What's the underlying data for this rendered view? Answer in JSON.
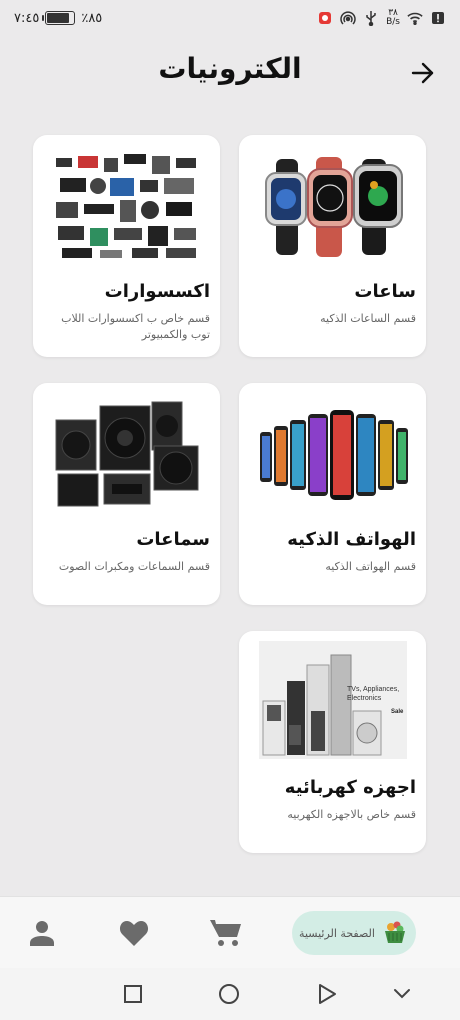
{
  "status_bar": {
    "time": "٧:٤٥",
    "battery_percent": "٪٨٥",
    "battery_level": 0.85,
    "net_speed_value": "٣٨",
    "net_speed_unit": "B/s"
  },
  "header": {
    "title": "الكترونيات"
  },
  "cards": [
    {
      "title": "ساعات",
      "desc": "قسم الساعات الذكيه"
    },
    {
      "title": "اكسسوارات",
      "desc": "قسم خاص ب اكسسوارات اللاب توب والكمبيوتر"
    },
    {
      "title": "الهواتف الذكيه",
      "desc": "قسم الهواتف الذكيه"
    },
    {
      "title": "سماعات",
      "desc": "قسم السماعات ومكبرات الصوت"
    },
    {
      "title": "اجهزه كهربائيه",
      "desc": "قسم خاص بالاجهزه الكهربيه"
    }
  ],
  "appliance_banner_text": "TVs, Appliances, Electronics",
  "appliance_banner_sale": "Sale",
  "bottom_nav": {
    "home_label": "الصفحة الرئيسية"
  },
  "colors": {
    "background": "#ebeaeb",
    "home_pill": "#d3ede5",
    "nav_icon": "#6b6b6b"
  }
}
